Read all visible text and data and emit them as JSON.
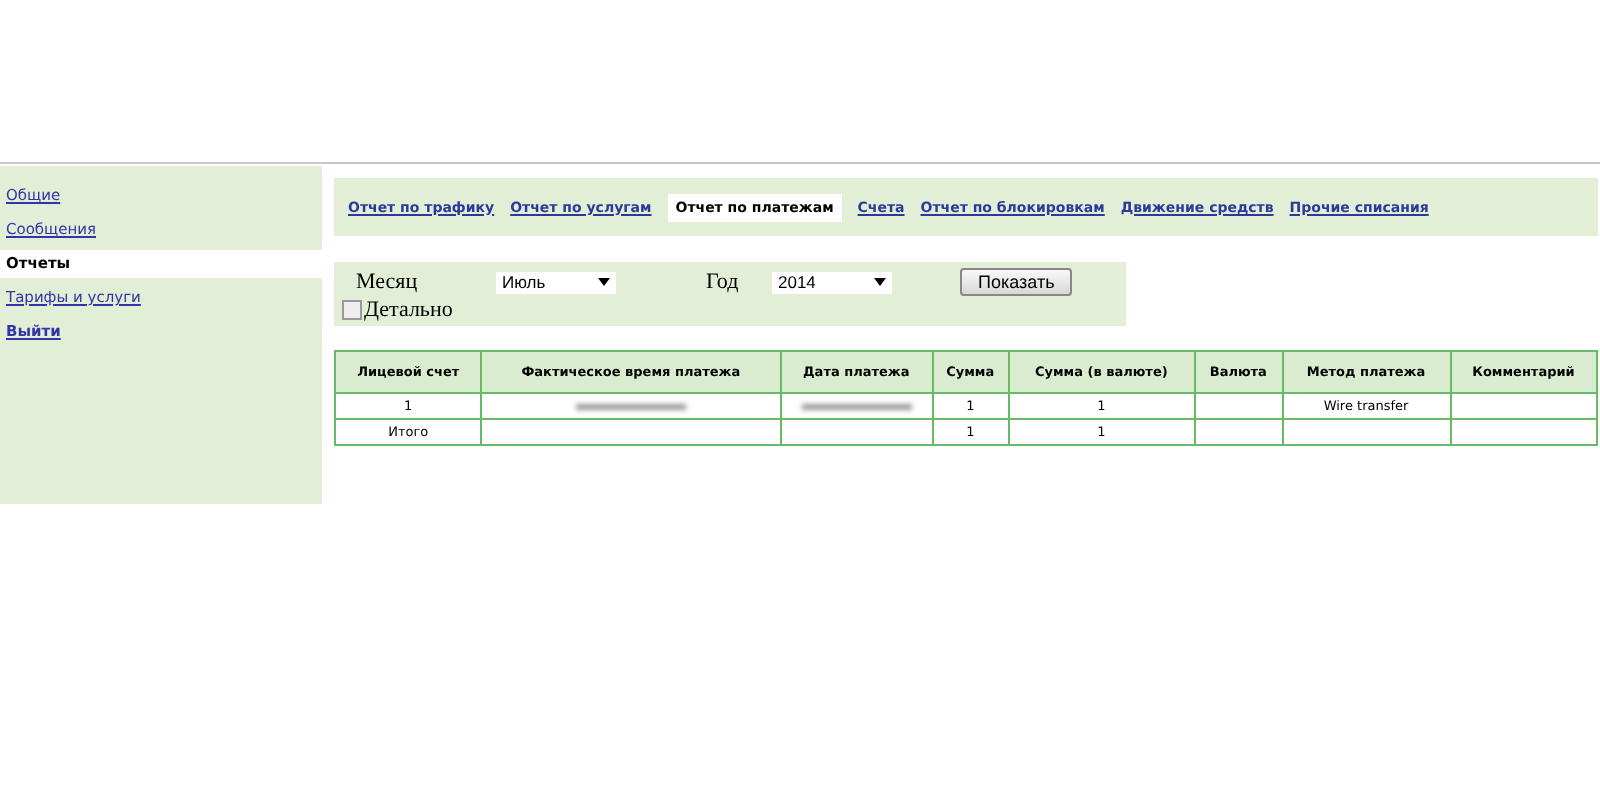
{
  "sidebar": {
    "items": [
      {
        "label": "Общие",
        "selected": false
      },
      {
        "label": "Сообщения",
        "selected": false
      },
      {
        "label": "Отчеты",
        "selected": true
      },
      {
        "label": "Тарифы и услуги",
        "selected": false
      },
      {
        "label": "Выйти",
        "selected": false
      }
    ]
  },
  "tabs": [
    {
      "label": "Отчет по трафику",
      "selected": false
    },
    {
      "label": "Отчет по услугам",
      "selected": false
    },
    {
      "label": "Отчет по платежам",
      "selected": true
    },
    {
      "label": "Счета",
      "selected": false
    },
    {
      "label": "Отчет по блокировкам",
      "selected": false
    },
    {
      "label": "Движение средств",
      "selected": false
    },
    {
      "label": "Прочие списания",
      "selected": false
    }
  ],
  "filters": {
    "month_label": "Месяц",
    "month_value": "Июль",
    "year_label": "Год",
    "year_value": "2014",
    "show_button": "Показать",
    "detail": {
      "label": "Детально",
      "checked": false
    }
  },
  "table": {
    "columns": [
      "Лицевой счет",
      "Фактическое время платежа",
      "Дата платежа",
      "Сумма",
      "Сумма (в валюте)",
      "Валюта",
      "Метод платежа",
      "Комментарий"
    ],
    "rows": [
      [
        {
          "text": "1"
        },
        {
          "redacted": true
        },
        {
          "redacted": true
        },
        {
          "text": "1"
        },
        {
          "text": "1"
        },
        {},
        {
          "text": "Wire transfer"
        },
        {}
      ],
      [
        {
          "text": "Итого"
        },
        {},
        {},
        {
          "text": "1"
        },
        {
          "text": "1"
        },
        {},
        {},
        {}
      ]
    ]
  }
}
